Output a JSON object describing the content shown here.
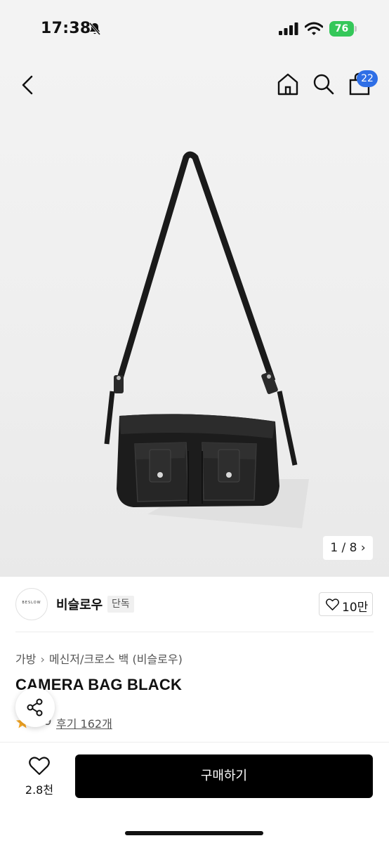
{
  "status_bar": {
    "time": "17:38",
    "battery": "76"
  },
  "header": {
    "cart_count": "22",
    "icons": [
      "chevron-left-icon",
      "home-icon",
      "search-icon",
      "shopping-bag-icon"
    ]
  },
  "gallery": {
    "indicator": "1 / 8 ›",
    "current": 1,
    "total": 8
  },
  "brand": {
    "logo_text": "BESLOW",
    "name": "비슬로우",
    "badge": "단독",
    "likes": "10만"
  },
  "product": {
    "breadcrumb": [
      "가방",
      "메신저/크로스 백 (비슬로우)"
    ],
    "title": "CAMERA BAG BLACK",
    "rating": "4.9",
    "reviews": "후기 162개"
  },
  "bottom_bar": {
    "wish_count": "2.8천",
    "buy_label": "구매하기"
  },
  "colors": {
    "accent_badge": "#2f6fe6",
    "battery": "#34c759",
    "buy_button": "#000000",
    "star": "#f5a623"
  }
}
